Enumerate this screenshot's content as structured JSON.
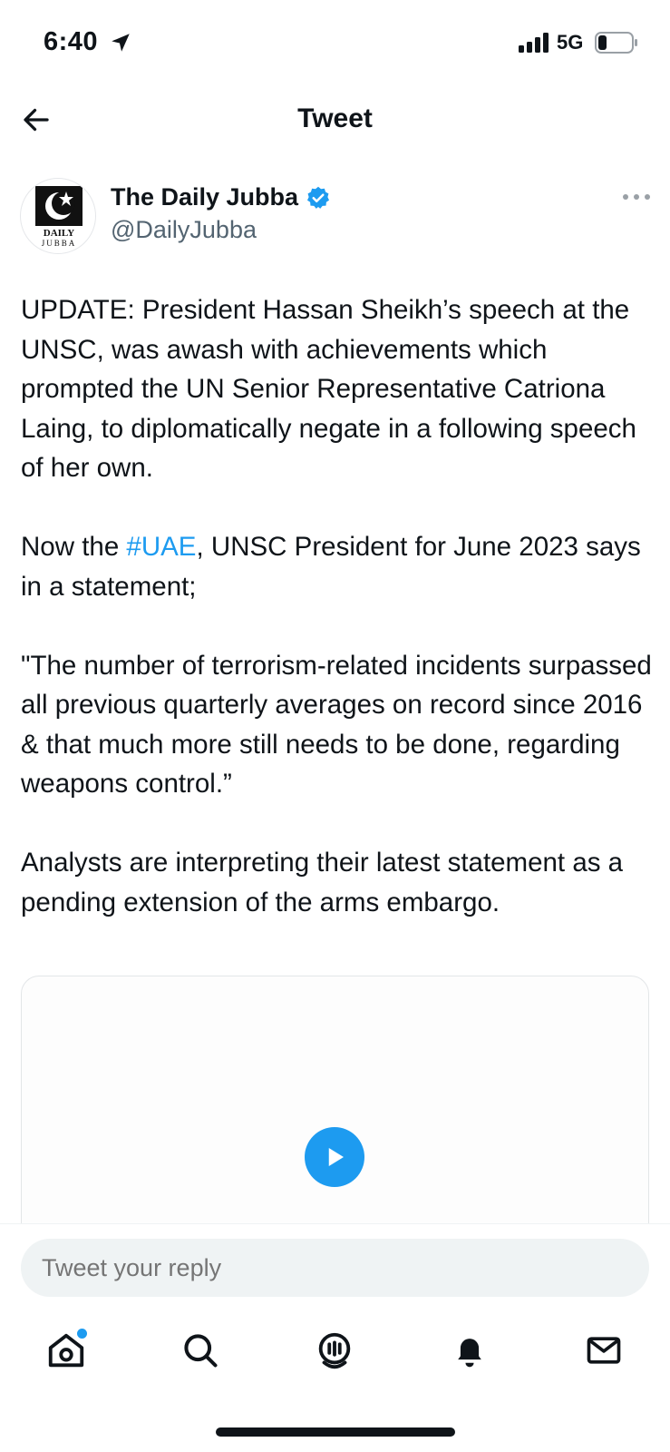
{
  "status_bar": {
    "time": "6:40",
    "network": "5G",
    "icons": [
      "location-arrow-icon",
      "signal-bars-icon",
      "battery-icon"
    ]
  },
  "header": {
    "title": "Tweet",
    "back_icon": "arrow-left-icon"
  },
  "author": {
    "display_name": "The Daily Jubba",
    "handle": "@DailyJubba",
    "verified": true,
    "avatar_text_top": "DAILY",
    "avatar_text_bottom": "JUBBA"
  },
  "tweet": {
    "paragraph_1": "UPDATE: President Hassan Sheikh’s speech at the UNSC, was awash with achievements which prompted the UN Senior Representative Catriona Laing, to diplomatically negate in a following speech of her own.",
    "paragraph_2_before": "Now the ",
    "paragraph_2_hashtag": "#UAE",
    "paragraph_2_after": ", UNSC President for June 2023 says in a statement;",
    "paragraph_3": "\"The number of terrorism-related incidents surpassed all previous quarterly averages on record since 2016 & that much more still needs to be done, regarding weapons control.”",
    "paragraph_4": "Analysts are interpreting their latest statement as a pending extension of the arms embargo."
  },
  "media": {
    "type": "video",
    "play_icon": "play-icon"
  },
  "reply": {
    "placeholder": "Tweet your reply"
  },
  "nav": {
    "items": [
      "home-icon",
      "search-icon",
      "spaces-icon",
      "notifications-icon",
      "messages-icon"
    ],
    "home_has_notification": true
  },
  "colors": {
    "accent": "#1d9bf0",
    "text": "#0f1419",
    "secondary_text": "#536471",
    "input_bg": "#eff3f4"
  }
}
